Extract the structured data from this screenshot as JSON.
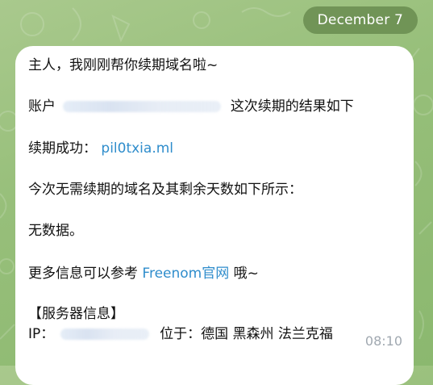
{
  "date_label": "December 7",
  "message": {
    "greeting": "主人，我刚刚帮你续期域名啦~",
    "account_prefix": "账户",
    "account_suffix": "这次续期的结果如下",
    "renew_success_label": "续期成功：",
    "renew_success_domain": "pil0txia.ml",
    "no_renew_line": "今次无需续期的域名及其剩余天数如下所示：",
    "no_data": "无数据。",
    "more_info_prefix": "更多信息可以参考",
    "more_info_link": "Freenom官网",
    "more_info_suffix": "哦~",
    "server_info_header": "【服务器信息】",
    "ip_label": "IP：",
    "location_label": "位于：德国 黑森州 法兰克福",
    "time": "08:10"
  },
  "colors": {
    "background": "#97bf7a",
    "bubble": "#ffffff",
    "link": "#2f8dcc",
    "date_pill": "#5f8246"
  }
}
